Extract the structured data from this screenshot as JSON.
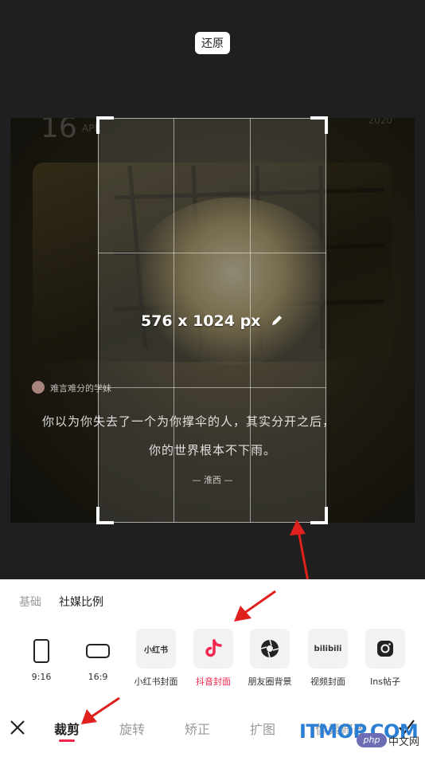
{
  "header": {
    "reset_label": "还原"
  },
  "photo": {
    "date_big": "16",
    "date_month": "APR",
    "year": "2020",
    "author": "难言难分的学妹",
    "quote_line1": "你以为你失去了一个为你撑伞的人，其实分开之后，",
    "quote_line2": "你的世界根本不下雨。",
    "signature": "— 淮西 —"
  },
  "crop": {
    "size_label": "576 x 1024 px"
  },
  "categories": {
    "basic": "基础",
    "social": "社媒比例"
  },
  "ratios": [
    {
      "label": "9:16",
      "icon": "portrait-rect-icon"
    },
    {
      "label": "16:9",
      "icon": "landscape-rect-icon"
    },
    {
      "label": "小红书封面",
      "tile_text": "小红书",
      "icon": "xiaohongshu-icon"
    },
    {
      "label": "抖音封面",
      "icon": "tiktok-icon",
      "selected": true
    },
    {
      "label": "朋友圈背景",
      "icon": "moments-shutter-icon"
    },
    {
      "label": "视频封面",
      "tile_text": "bilibili",
      "icon": "bilibili-icon"
    },
    {
      "label": "Ins帖子",
      "icon": "instagram-icon"
    },
    {
      "label": "In"
    }
  ],
  "tools": [
    "裁剪",
    "旋转",
    "矫正",
    "扩图",
    "像素修改"
  ],
  "colors": {
    "accent": "#f0264e",
    "annotation_arrow": "#e0201c"
  },
  "watermark": {
    "brand": "ITMOP.COM",
    "badge": "php",
    "cn": "中文网"
  }
}
